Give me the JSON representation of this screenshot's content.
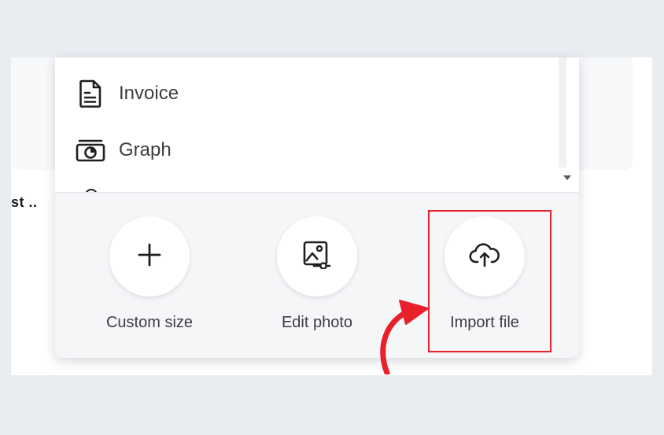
{
  "background_text": "st ..",
  "menu": {
    "items": [
      {
        "label": "Invoice",
        "icon": "document-icon"
      },
      {
        "label": "Graph",
        "icon": "graph-icon"
      }
    ]
  },
  "actions": [
    {
      "label": "Custom size",
      "icon": "plus-icon"
    },
    {
      "label": "Edit photo",
      "icon": "edit-photo-icon"
    },
    {
      "label": "Import file",
      "icon": "cloud-upload-icon"
    }
  ],
  "colors": {
    "highlight": "#e8202a",
    "arrow": "#e8202a",
    "page_bg": "#e9edf2"
  }
}
